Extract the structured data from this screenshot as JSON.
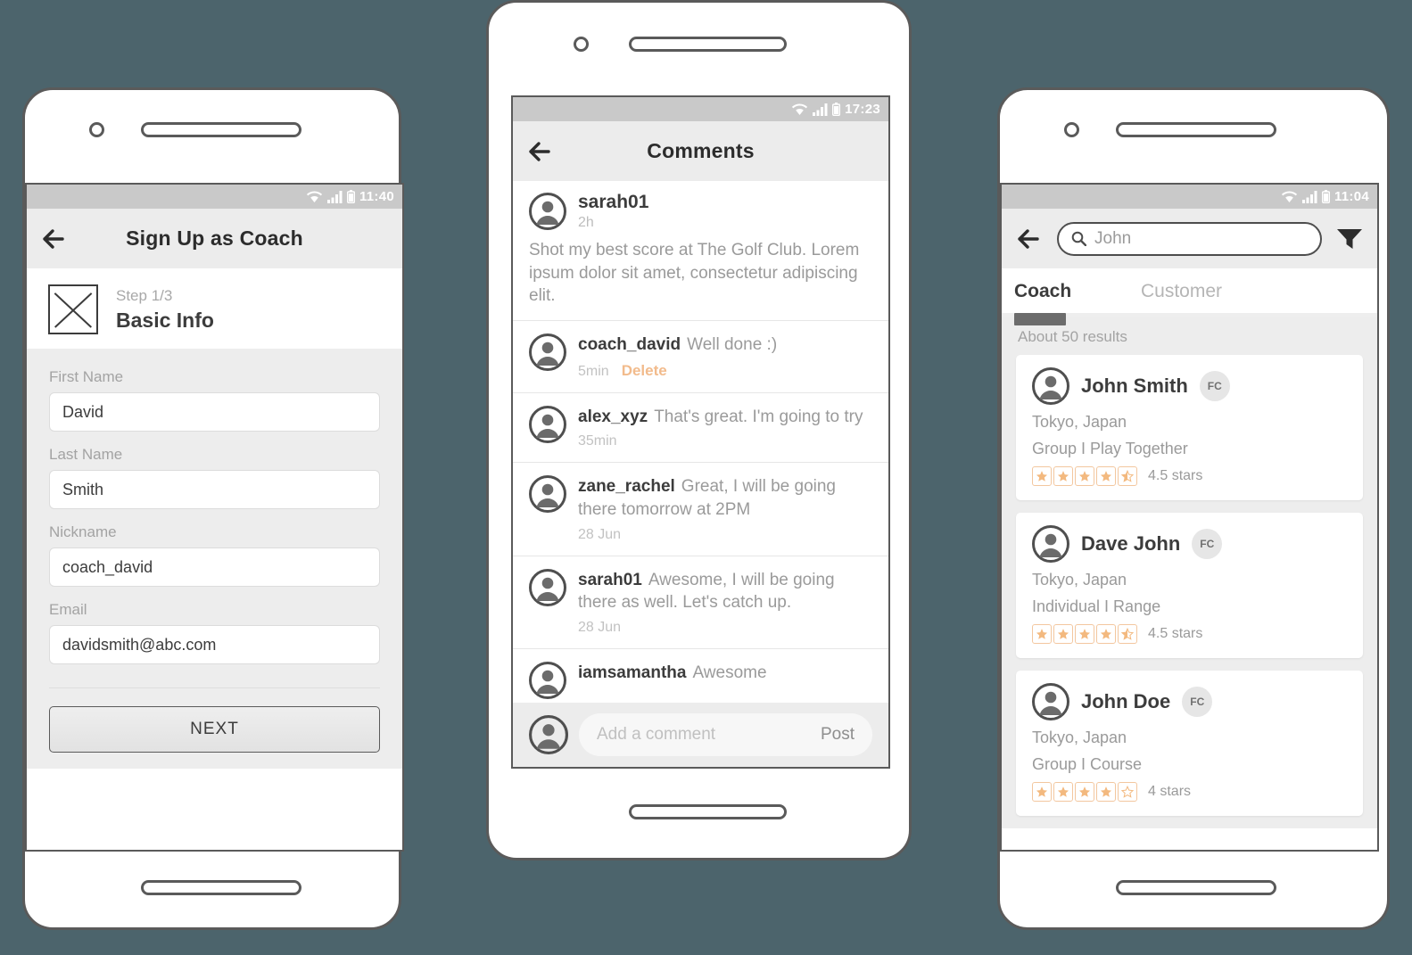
{
  "theme": {
    "page_background": "#4c646c",
    "accent_orange": "#f2bb8c",
    "star_color": "#f3b97f",
    "text_dark": "#3c3c3c",
    "text_muted": "#9a9a9a"
  },
  "phone1": {
    "status": {
      "time": "11:40",
      "icons": [
        "wifi-icon",
        "signal-icon",
        "battery-icon"
      ]
    },
    "appbar": {
      "title": "Sign Up as Coach",
      "back": "back-arrow-icon"
    },
    "step": {
      "label": "Step 1/3",
      "title": "Basic Info",
      "thumb": "image-placeholder-icon"
    },
    "fields": [
      {
        "label": "First Name",
        "value": "David"
      },
      {
        "label": "Last Name",
        "value": "Smith"
      },
      {
        "label": "Nickname",
        "value": "coach_david"
      },
      {
        "label": "Email",
        "value": "davidsmith@abc.com"
      }
    ],
    "next_label": "NEXT"
  },
  "phone2": {
    "status": {
      "time": "17:23",
      "icons": [
        "wifi-icon",
        "signal-icon",
        "battery-icon"
      ]
    },
    "appbar": {
      "title": "Comments",
      "back": "back-arrow-icon"
    },
    "post": {
      "user": "sarah01",
      "time": "2h",
      "body": "Shot my best score at The Golf Club. Lorem ipsum dolor sit amet, consectetur adipiscing elit."
    },
    "comments": [
      {
        "user": "coach_david",
        "text": "Well done :)",
        "time": "5min",
        "delete": "Delete"
      },
      {
        "user": "alex_xyz",
        "text": "That's great. I'm going to try",
        "time": "35min",
        "delete": ""
      },
      {
        "user": "zane_rachel",
        "text": "Great, I will be going there tomorrow at 2PM",
        "time": "28 Jun",
        "delete": ""
      },
      {
        "user": "sarah01",
        "text": "Awesome, I will be going there as well. Let's catch up.",
        "time": "28 Jun",
        "delete": ""
      },
      {
        "user": "iamsamantha",
        "text": "Awesome",
        "time": "",
        "delete": ""
      }
    ],
    "compose": {
      "placeholder": "Add a comment",
      "post_label": "Post"
    }
  },
  "phone3": {
    "status": {
      "time": "11:04",
      "icons": [
        "wifi-icon",
        "signal-icon",
        "battery-icon"
      ]
    },
    "search": {
      "value": "John",
      "icon": "search-icon",
      "filter": "filter-icon",
      "back": "back-arrow-icon"
    },
    "tabs": [
      {
        "label": "Coach",
        "active": true
      },
      {
        "label": "Customer",
        "active": false
      }
    ],
    "results_count": "About 50 results",
    "results": [
      {
        "name": "John Smith",
        "badge": "FC",
        "location": "Tokyo, Japan",
        "detail": "Group I Play Together",
        "stars_full": 4,
        "stars_half": 1,
        "rating_text": "4.5 stars"
      },
      {
        "name": "Dave John",
        "badge": "FC",
        "location": "Tokyo, Japan",
        "detail": "Individual I Range",
        "stars_full": 4,
        "stars_half": 1,
        "rating_text": "4.5 stars"
      },
      {
        "name": "John Doe",
        "badge": "FC",
        "location": "Tokyo, Japan",
        "detail": "Group I Course",
        "stars_full": 4,
        "stars_half": 0,
        "rating_text": "4 stars"
      }
    ]
  }
}
